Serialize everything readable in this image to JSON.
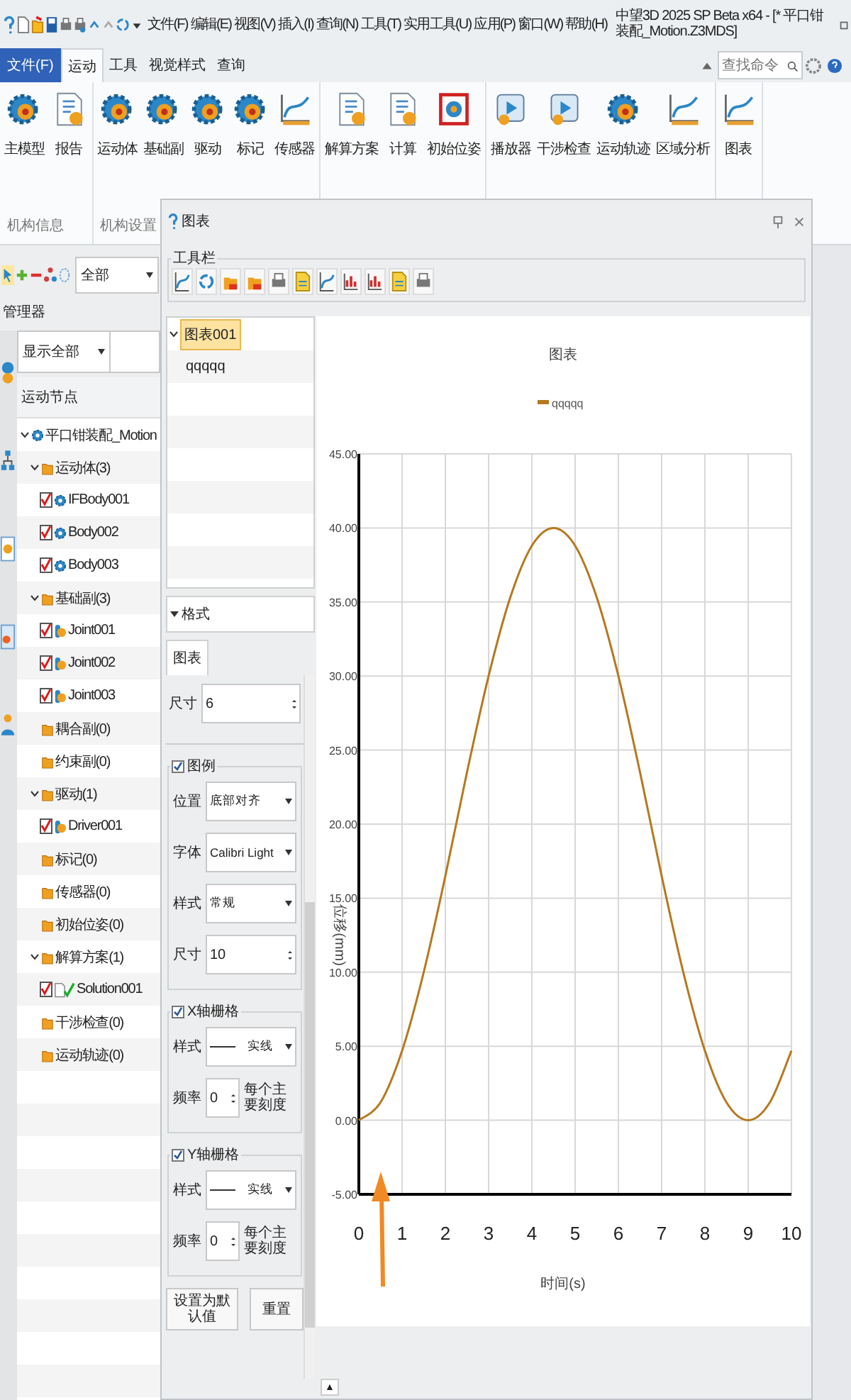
{
  "window": {
    "title": "中望3D 2025 SP Beta x64 - [* 平口钳装配_Motion.Z3MDS]"
  },
  "menu_bar": [
    "文件(F)",
    "编辑(E)",
    "视图(V)",
    "插入(I)",
    "查询(N)",
    "工具(T)",
    "实用工具(U)",
    "应用(P)",
    "窗口(W)",
    "帮助(H)"
  ],
  "ribbon": {
    "file_button": "文件(F)",
    "tabs": [
      {
        "label": "运动",
        "selected": true
      },
      {
        "label": "工具",
        "selected": false
      },
      {
        "label": "视觉样式",
        "selected": false
      },
      {
        "label": "查询",
        "selected": false
      }
    ],
    "search": {
      "placeholder": "查找命令"
    },
    "groups": [
      {
        "label": "机构信息",
        "buttons": [
          {
            "label": "主模型",
            "kind": "gear"
          },
          {
            "label": "报告",
            "kind": "document"
          }
        ]
      },
      {
        "label": "机构设置",
        "buttons": [
          {
            "label": "运动体",
            "kind": "gear"
          },
          {
            "label": "基础副",
            "kind": "gear"
          },
          {
            "label": "驱动",
            "kind": "gear"
          },
          {
            "label": "标记",
            "kind": "gear"
          },
          {
            "label": "传感器",
            "kind": "chart"
          }
        ]
      },
      {
        "buttons": [
          {
            "label": "解算方案",
            "kind": "document"
          },
          {
            "label": "计算",
            "kind": "document"
          },
          {
            "label": "初始位姿",
            "kind": "frame"
          }
        ]
      },
      {
        "buttons": [
          {
            "label": "播放器",
            "kind": "player"
          },
          {
            "label": "干涉检查",
            "kind": "player"
          },
          {
            "label": "运动轨迹",
            "kind": "gear"
          },
          {
            "label": "区域分析",
            "kind": "chart"
          }
        ]
      },
      {
        "buttons": [
          {
            "label": "图表",
            "kind": "chart"
          }
        ]
      }
    ]
  },
  "manager": {
    "filter": "全部",
    "title": "管理器",
    "view": "显示全部",
    "header": "运动节点",
    "tree": [
      {
        "label": "平口钳装配_Motion",
        "kind": "root",
        "expanded": true,
        "children": [
          {
            "label": "运动体(3)",
            "kind": "folder",
            "expanded": true,
            "children": [
              {
                "label": "IFBody001",
                "kind": "body",
                "checked": true
              },
              {
                "label": "Body002",
                "kind": "body",
                "checked": true
              },
              {
                "label": "Body003",
                "kind": "body",
                "checked": true
              }
            ]
          },
          {
            "label": "基础副(3)",
            "kind": "folder",
            "expanded": true,
            "children": [
              {
                "label": "Joint001",
                "kind": "joint",
                "checked": true
              },
              {
                "label": "Joint002",
                "kind": "joint",
                "checked": true
              },
              {
                "label": "Joint003",
                "kind": "joint",
                "checked": true
              }
            ]
          },
          {
            "label": "耦合副(0)",
            "kind": "folder"
          },
          {
            "label": "约束副(0)",
            "kind": "folder"
          },
          {
            "label": "驱动(1)",
            "kind": "folder",
            "expanded": true,
            "children": [
              {
                "label": "Driver001",
                "kind": "joint",
                "checked": true
              }
            ]
          },
          {
            "label": "标记(0)",
            "kind": "folder"
          },
          {
            "label": "传感器(0)",
            "kind": "folder"
          },
          {
            "label": "初始位姿(0)",
            "kind": "folder"
          },
          {
            "label": "解算方案(1)",
            "kind": "folder",
            "expanded": true,
            "children": [
              {
                "label": "Solution001",
                "kind": "solution",
                "checked": true
              }
            ]
          },
          {
            "label": "干涉检查(0)",
            "kind": "folder"
          },
          {
            "label": "运动轨迹(0)",
            "kind": "folder"
          }
        ]
      }
    ]
  },
  "dialog": {
    "title": "图表",
    "toolbar_label": "工具栏",
    "chart_list": [
      {
        "label": "图表001",
        "selected": true,
        "expanded": true,
        "children": [
          {
            "label": "qqqqq",
            "selected": false
          }
        ]
      }
    ],
    "format": {
      "title": "格式",
      "tabs": [
        {
          "label": "图表",
          "selected": true
        }
      ],
      "size": {
        "label": "尺寸",
        "value": "6"
      },
      "groups": [
        {
          "label": "图例",
          "checked": true,
          "fields": [
            {
              "label": "位置",
              "value": "底部对齐",
              "kind": "select"
            },
            {
              "label": "字体",
              "value": "Calibri Light",
              "kind": "select"
            },
            {
              "label": "样式",
              "value": "常规",
              "kind": "select"
            },
            {
              "label": "尺寸",
              "value": "10",
              "kind": "spin"
            }
          ]
        },
        {
          "label": "X轴栅格",
          "checked": true,
          "fields": [
            {
              "label": "样式",
              "value": "实线",
              "kind": "line"
            },
            {
              "label": "频率",
              "value": "0",
              "kind": "spin",
              "unit": "每个主要刻度"
            }
          ]
        },
        {
          "label": "Y轴栅格",
          "checked": true,
          "fields": [
            {
              "label": "样式",
              "value": "实线",
              "kind": "line"
            },
            {
              "label": "频率",
              "value": "0",
              "kind": "spin",
              "unit": "每个主要刻度"
            }
          ]
        }
      ],
      "buttons": [
        "设置为默认值",
        "重置"
      ]
    },
    "chart_data": {
      "type": "line",
      "title": "图表",
      "xlabel": "时间(s)",
      "ylabel": "位移(mm)",
      "x": [
        0,
        0.5,
        1,
        1.5,
        2,
        2.5,
        3,
        3.5,
        4,
        4.5,
        5,
        5.5,
        6,
        6.5,
        7,
        7.5,
        8,
        8.5,
        9,
        9.5,
        10
      ],
      "series": [
        {
          "name": "qqqqq",
          "color": "#b5791f",
          "values": [
            0,
            1.2,
            4.7,
            10,
            16.5,
            23.5,
            30,
            35.3,
            38.8,
            40,
            38.8,
            35.3,
            30,
            23.5,
            16.5,
            10,
            4.7,
            1.2,
            0,
            1.2,
            4.7
          ]
        }
      ],
      "grid": true,
      "xlim": [
        0,
        10
      ],
      "ylim": [
        -5,
        45
      ],
      "xticks": [
        0,
        1,
        2,
        3,
        4,
        5,
        6,
        7,
        8,
        9,
        10
      ],
      "yticks": [
        {
          "value": -5,
          "label": "-5.00"
        },
        {
          "value": 0,
          "label": "0.00"
        },
        {
          "value": 5,
          "label": "5.00"
        },
        {
          "value": 10,
          "label": "10.00"
        },
        {
          "value": 15,
          "label": "15.00"
        },
        {
          "value": 20,
          "label": "20.00"
        },
        {
          "value": 25,
          "label": "25.00"
        },
        {
          "value": 30,
          "label": "30.00"
        },
        {
          "value": 35,
          "label": "35.00"
        },
        {
          "value": 40,
          "label": "40.00"
        },
        {
          "value": 45,
          "label": "45.00"
        }
      ]
    },
    "collapse_button": "▲"
  }
}
